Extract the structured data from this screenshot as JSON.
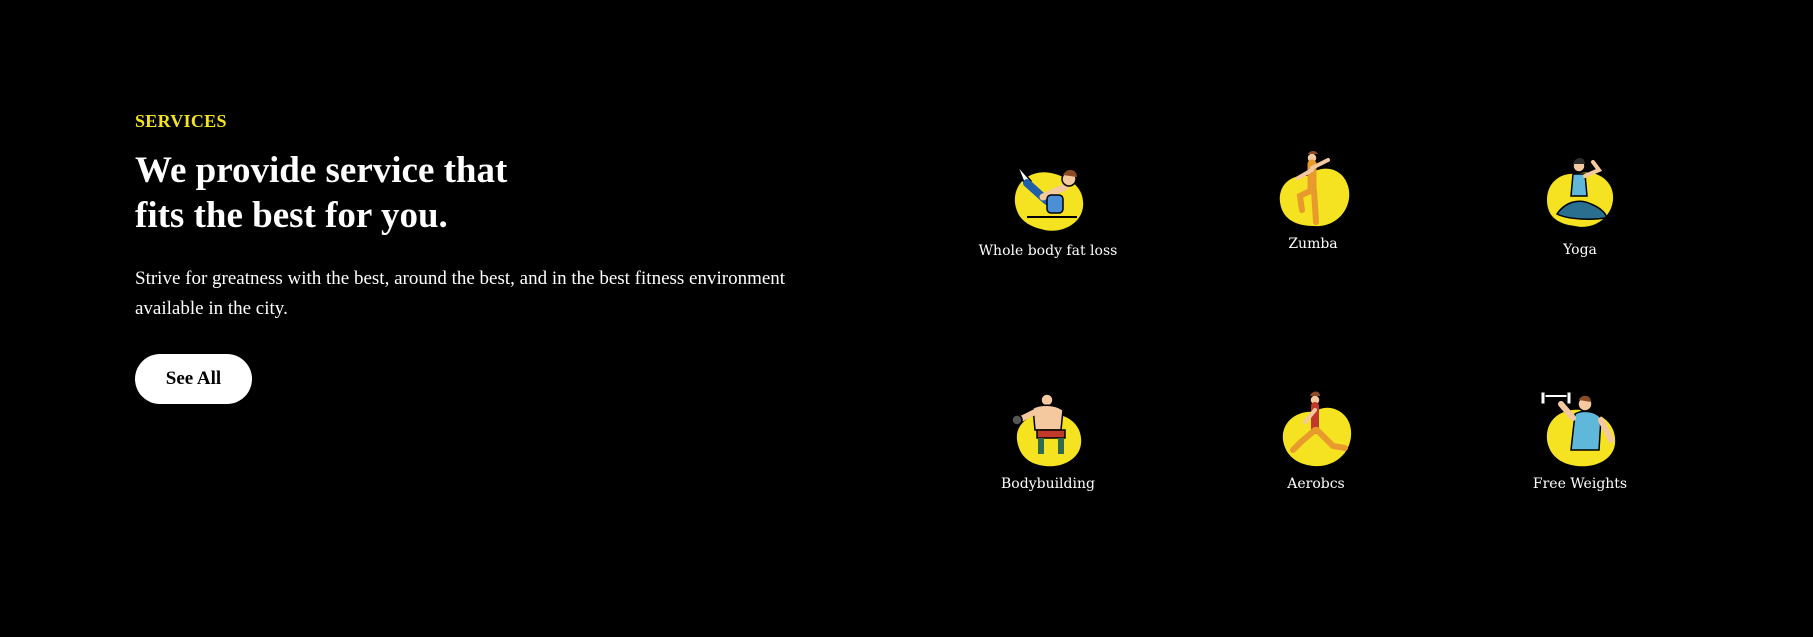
{
  "hero": {
    "eyebrow": "SERVICES",
    "heading": "We provide service that fits the best for you.",
    "description": "Strive for greatness with the best, around the best, and in the best fitness environment available in the city.",
    "cta_label": "See All"
  },
  "services": [
    {
      "label": "Whole body fat loss",
      "icon": "fat-loss-icon"
    },
    {
      "label": "Zumba",
      "icon": "zumba-icon"
    },
    {
      "label": "Yoga",
      "icon": "yoga-icon"
    },
    {
      "label": "Bodybuilding",
      "icon": "bodybuilding-icon"
    },
    {
      "label": "Aerobcs",
      "icon": "aerobics-icon"
    },
    {
      "label": "Free Weights",
      "icon": "free-weights-icon"
    }
  ],
  "colors": {
    "background": "#000000",
    "accent": "#f5e321",
    "text": "#ffffff"
  }
}
